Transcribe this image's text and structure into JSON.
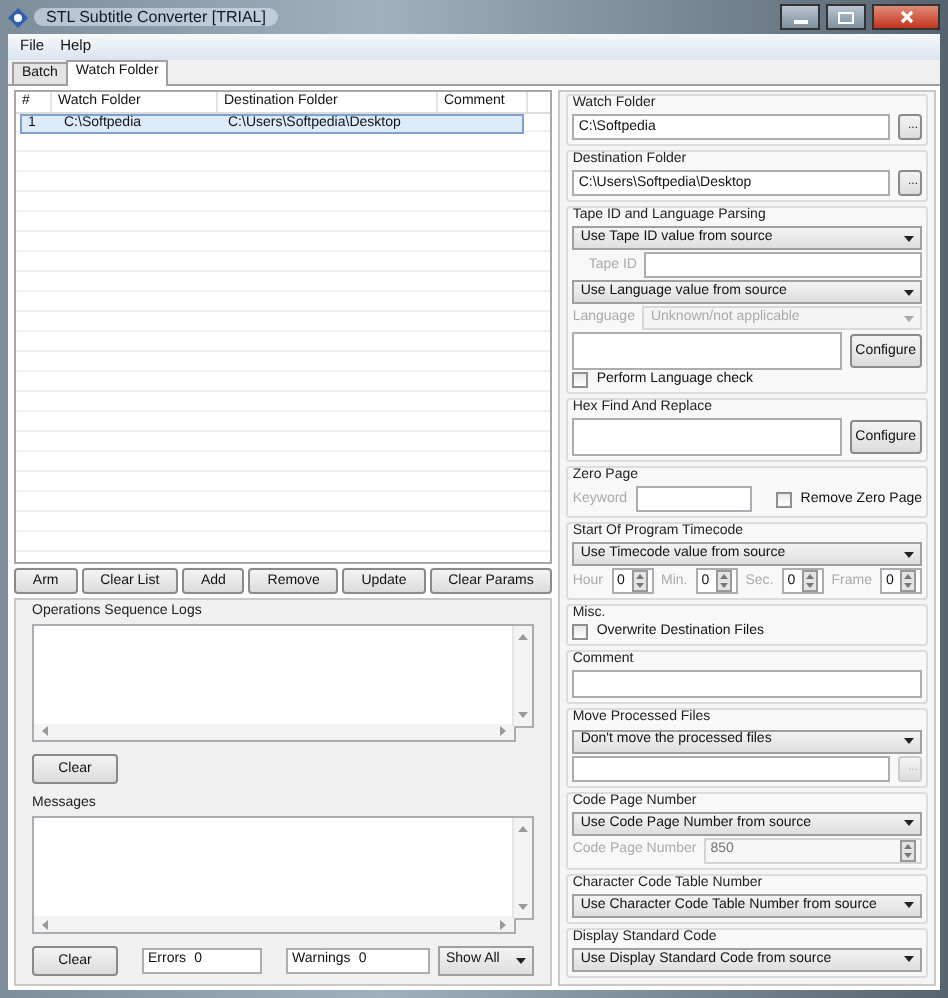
{
  "window": {
    "title": "STL Subtitle Converter [TRIAL]"
  },
  "menu": [
    "File",
    "Help"
  ],
  "tabs": [
    {
      "label": "Batch",
      "selected": false
    },
    {
      "label": "Watch Folder",
      "selected": true
    }
  ],
  "watch_table": {
    "columns": [
      "#",
      "Watch Folder",
      "Destination Folder",
      "Comment"
    ],
    "rows": [
      {
        "number": "1",
        "watch_folder": "C:\\Softpedia",
        "destination_folder": "C:\\Users\\Softpedia\\Desktop",
        "selected": true
      }
    ]
  },
  "buttons": [
    "Arm",
    "Clear List",
    "Add",
    "Remove",
    "Update",
    "Clear Params"
  ],
  "operations_log": {
    "title": "Operations Sequence Logs",
    "clear_button": "Clear"
  },
  "messages": {
    "title": "Messages",
    "clear_button": "Clear",
    "errors_label": "Errors",
    "errors_value": "0",
    "warnings_label": "Warnings",
    "warnings_value": "0",
    "filter": "Show All"
  },
  "settings": [
    {
      "title": "Watch Folder",
      "controls": [
        {
          "kind": "path",
          "value": "C:\\Softpedia",
          "browse": "...",
          "disabled": false
        }
      ]
    },
    {
      "title": "Destination Folder",
      "controls": [
        {
          "kind": "path",
          "value": "C:\\Users\\Softpedia\\Desktop",
          "browse": "...",
          "disabled": false
        }
      ]
    },
    {
      "title": "Tape ID and Language Parsing",
      "controls": [
        {
          "kind": "select",
          "value": "Use Tape ID value from source",
          "disabled": false
        },
        {
          "kind": "labeled_text",
          "label": "Tape ID",
          "disabled": true
        },
        {
          "kind": "select",
          "value": "Use Language value from source",
          "disabled": false
        },
        {
          "kind": "labeled_select",
          "label": "Language",
          "value": "Unknown/not applicable",
          "disabled": true
        },
        {
          "kind": "memo_button",
          "button": "Configure"
        },
        {
          "kind": "checkbox",
          "label": "Perform Language check",
          "checked": false
        }
      ]
    },
    {
      "title": "Hex Find And Replace",
      "controls": [
        {
          "kind": "memo_button",
          "button": "Configure"
        }
      ]
    },
    {
      "title": "Zero Page",
      "controls": [
        {
          "kind": "keyword_check",
          "label": "Keyword",
          "check_label": "Remove Zero Page",
          "checked": false,
          "disabled": true
        }
      ]
    },
    {
      "title": "Start Of Program Timecode",
      "controls": [
        {
          "kind": "select",
          "value": "Use Timecode value from source",
          "disabled": false
        },
        {
          "kind": "timecode",
          "disabled": true,
          "fields": [
            {
              "label": "Hour",
              "value": "0"
            },
            {
              "label": "Min.",
              "value": "0"
            },
            {
              "label": "Sec.",
              "value": "0"
            },
            {
              "label": "Frame",
              "value": "0"
            }
          ]
        }
      ]
    },
    {
      "title": "Misc.",
      "controls": [
        {
          "kind": "checkbox",
          "label": "Overwrite Destination Files",
          "checked": false
        }
      ]
    },
    {
      "title": "Comment",
      "controls": [
        {
          "kind": "text"
        }
      ]
    },
    {
      "title": "Move Processed Files",
      "controls": [
        {
          "kind": "select",
          "value": "Don't move the processed files",
          "disabled": false
        },
        {
          "kind": "path",
          "browse": "...",
          "disabled": true
        }
      ]
    },
    {
      "title": "Code Page Number",
      "controls": [
        {
          "kind": "select",
          "value": "Use Code Page Number from source",
          "disabled": false
        },
        {
          "kind": "labeled_spin",
          "label": "Code Page Number",
          "value": "850",
          "disabled": true
        }
      ]
    },
    {
      "title": "Character Code Table Number",
      "controls": [
        {
          "kind": "select",
          "value": "Use Character Code Table Number from source",
          "disabled": false
        }
      ]
    },
    {
      "title": "Display Standard Code",
      "controls": [
        {
          "kind": "select",
          "value": "Use Display Standard Code from source",
          "disabled": false
        }
      ]
    }
  ]
}
